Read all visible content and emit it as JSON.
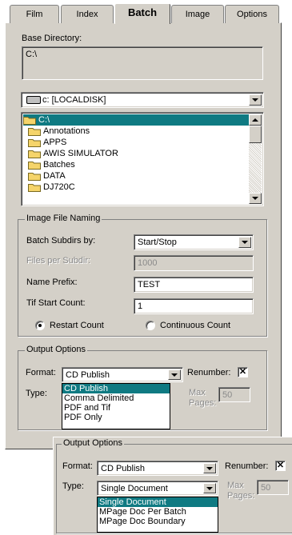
{
  "colors": {
    "face": "#d4d0c8",
    "selection": "#0f7a82"
  },
  "tabs": [
    "Film",
    "Index",
    "Batch",
    "Image",
    "Options"
  ],
  "active_tab": "Batch",
  "base_directory": {
    "label": "Base Directory:",
    "value": "C:\\"
  },
  "drive": {
    "value": "c: [LOCALDISK]"
  },
  "folders": [
    "C:\\",
    "Annotations",
    "APPS",
    "AWIS SIMULATOR",
    "Batches",
    "DATA",
    "DJ720C"
  ],
  "image_naming": {
    "legend": "Image File Naming",
    "subdirs_label": "Batch Subdirs by:",
    "subdirs_value": "Start/Stop",
    "files_label": "Files per Subdir:",
    "files_value": "1000",
    "prefix_label": "Name Prefix:",
    "prefix_value": "TEST",
    "tif_label": "Tif Start Count:",
    "tif_value": "1",
    "restart_label": "Restart Count",
    "continuous_label": "Continuous Count"
  },
  "output": {
    "legend": "Output Options",
    "format_label": "Format:",
    "format_value": "CD Publish",
    "type_label": "Type:",
    "renumber_label": "Renumber:",
    "renumber_mark": "✕",
    "max_label": "Max",
    "pages_label": "Pages:",
    "max_value": "50",
    "format_options": [
      "CD Publish",
      "Comma Delimited",
      "PDF and Tif",
      "PDF Only"
    ]
  },
  "output2": {
    "legend": "Output Options",
    "format_label": "Format:",
    "format_value": "CD Publish",
    "type_label": "Type:",
    "type_value": "Single Document",
    "renumber_label": "Renumber:",
    "renumber_mark": "✕",
    "max_label": "Max",
    "pages_label": "Pages:",
    "max_value": "50",
    "type_options": [
      "Single Document",
      "MPage Doc Per Batch",
      "MPage Doc Boundary"
    ]
  }
}
